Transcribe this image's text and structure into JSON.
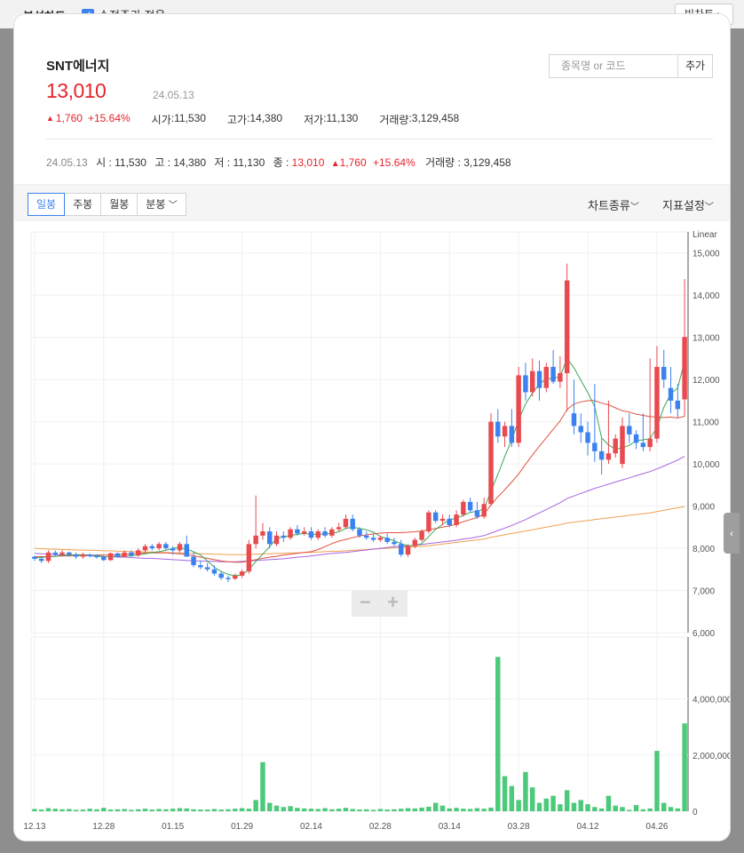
{
  "header": {
    "title": "분석차트",
    "adjusted_label": "수정주가 적용",
    "big_chart_label": "빅차트"
  },
  "stock": {
    "name": "SNT에너지",
    "price": "13,010",
    "date": "24.05.13",
    "change": "1,760",
    "change_pct": "+15.64%",
    "open_label": "시가",
    "open": "11,530",
    "high_label": "고가",
    "high": "14,380",
    "low_label": "저가",
    "low": "11,130",
    "volume_label": "거래량",
    "volume": "3,129,458"
  },
  "search": {
    "placeholder": "종목명 or 코드",
    "add_label": "추가"
  },
  "detail": {
    "date": "24.05.13",
    "o_label": "시",
    "o": "11,530",
    "h_label": "고",
    "h": "14,380",
    "l_label": "저",
    "l": "11,130",
    "c_label": "종",
    "c": "13,010",
    "change": "1,760",
    "pct": "+15.64%",
    "v_label": "거래량",
    "v": "3,129,458"
  },
  "toolbar": {
    "tabs": [
      "일봉",
      "주봉",
      "월봉",
      "분봉"
    ],
    "active_tab": "일봉",
    "chart_type_label": "차트종류",
    "indicator_label": "지표설정"
  },
  "zoom": {
    "minus": "−",
    "plus": "+"
  },
  "colors": {
    "up": "#e84a4f",
    "down": "#3b82f0",
    "volume": "#4cc97a",
    "ma5": "#3aa757",
    "ma20": "#e0533f",
    "ma60": "#a766e0",
    "ma120": "#f0a050"
  },
  "chart_data": {
    "type": "candlestick",
    "scale_label": "Linear",
    "price_ylim": [
      6000,
      15500
    ],
    "price_ticks": [
      "15,000",
      "14,000",
      "13,000",
      "12,000",
      "11,000",
      "10,000",
      "9,000",
      "8,000",
      "7,000",
      "6,000"
    ],
    "volume_ylim": [
      0,
      5700000
    ],
    "volume_ticks": [
      "4,000,000",
      "2,000,000",
      "0"
    ],
    "x_labels": [
      "12.13",
      "12.28",
      "01.15",
      "01.29",
      "02.14",
      "02.28",
      "03.14",
      "03.28",
      "04.12",
      "04.26"
    ],
    "x_label_index": [
      0,
      10,
      20,
      30,
      40,
      50,
      60,
      70,
      80,
      90
    ],
    "ohlc": [
      [
        7800,
        7820,
        7700,
        7750
      ],
      [
        7750,
        7800,
        7650,
        7700
      ],
      [
        7700,
        7950,
        7650,
        7900
      ],
      [
        7900,
        7950,
        7800,
        7850
      ],
      [
        7850,
        7950,
        7800,
        7900
      ],
      [
        7900,
        7920,
        7800,
        7850
      ],
      [
        7850,
        7900,
        7750,
        7800
      ],
      [
        7800,
        7900,
        7750,
        7850
      ],
      [
        7850,
        7880,
        7780,
        7820
      ],
      [
        7820,
        7860,
        7760,
        7800
      ],
      [
        7800,
        7850,
        7700,
        7720
      ],
      [
        7720,
        7900,
        7700,
        7880
      ],
      [
        7880,
        7900,
        7780,
        7800
      ],
      [
        7800,
        7950,
        7780,
        7900
      ],
      [
        7900,
        7950,
        7800,
        7830
      ],
      [
        7830,
        8000,
        7800,
        7950
      ],
      [
        7950,
        8100,
        7900,
        8050
      ],
      [
        8050,
        8100,
        7950,
        8000
      ],
      [
        8000,
        8150,
        7950,
        8100
      ],
      [
        8100,
        8150,
        7950,
        8000
      ],
      [
        8000,
        8050,
        7850,
        7950
      ],
      [
        7950,
        8150,
        7900,
        8100
      ],
      [
        8100,
        8300,
        7900,
        7800
      ],
      [
        7800,
        7900,
        7550,
        7600
      ],
      [
        7600,
        7700,
        7500,
        7550
      ],
      [
        7550,
        7650,
        7450,
        7500
      ],
      [
        7500,
        7600,
        7350,
        7400
      ],
      [
        7400,
        7450,
        7250,
        7300
      ],
      [
        7300,
        7350,
        7200,
        7280
      ],
      [
        7280,
        7400,
        7250,
        7350
      ],
      [
        7350,
        7500,
        7300,
        7450
      ],
      [
        7450,
        8200,
        7400,
        8100
      ],
      [
        8100,
        9250,
        8000,
        8300
      ],
      [
        8300,
        8600,
        8200,
        8400
      ],
      [
        8400,
        8500,
        8000,
        8100
      ],
      [
        8100,
        8400,
        8050,
        8300
      ],
      [
        8300,
        8400,
        8150,
        8250
      ],
      [
        8250,
        8500,
        8200,
        8450
      ],
      [
        8450,
        8550,
        8300,
        8350
      ],
      [
        8350,
        8500,
        8300,
        8400
      ],
      [
        8400,
        8500,
        8200,
        8250
      ],
      [
        8250,
        8450,
        8200,
        8400
      ],
      [
        8400,
        8500,
        8250,
        8300
      ],
      [
        8300,
        8500,
        8250,
        8450
      ],
      [
        8450,
        8600,
        8400,
        8500
      ],
      [
        8500,
        8800,
        8450,
        8700
      ],
      [
        8700,
        8800,
        8400,
        8450
      ],
      [
        8450,
        8500,
        8250,
        8300
      ],
      [
        8300,
        8400,
        8200,
        8250
      ],
      [
        8250,
        8350,
        8150,
        8200
      ],
      [
        8200,
        8300,
        8150,
        8250
      ],
      [
        8250,
        8350,
        8100,
        8150
      ],
      [
        8150,
        8250,
        8050,
        8100
      ],
      [
        8100,
        8200,
        7800,
        7850
      ],
      [
        7850,
        8100,
        7800,
        8050
      ],
      [
        8050,
        8250,
        8000,
        8200
      ],
      [
        8200,
        8450,
        8150,
        8400
      ],
      [
        8400,
        8900,
        8350,
        8850
      ],
      [
        8850,
        8900,
        8600,
        8650
      ],
      [
        8650,
        8800,
        8550,
        8700
      ],
      [
        8700,
        8800,
        8500,
        8550
      ],
      [
        8550,
        8900,
        8500,
        8800
      ],
      [
        8800,
        9150,
        8750,
        9100
      ],
      [
        9100,
        9200,
        8850,
        8900
      ],
      [
        8900,
        9100,
        8700,
        8750
      ],
      [
        8750,
        9200,
        8700,
        9050
      ],
      [
        9050,
        11200,
        9000,
        11000
      ],
      [
        11000,
        11300,
        10500,
        10650
      ],
      [
        10650,
        11000,
        10400,
        10900
      ],
      [
        10900,
        11300,
        10400,
        10500
      ],
      [
        10500,
        12300,
        10400,
        12100
      ],
      [
        12100,
        12400,
        11500,
        11700
      ],
      [
        11700,
        12500,
        11600,
        12200
      ],
      [
        12200,
        12450,
        11500,
        11800
      ],
      [
        11800,
        12400,
        11700,
        12300
      ],
      [
        12300,
        12700,
        11900,
        11950
      ],
      [
        11950,
        12550,
        11800,
        12150
      ],
      [
        12150,
        14750,
        11250,
        14350
      ],
      [
        11200,
        12000,
        10700,
        10900
      ],
      [
        10900,
        11200,
        10500,
        10750
      ],
      [
        10750,
        11000,
        10200,
        10500
      ],
      [
        10500,
        11900,
        10050,
        10300
      ],
      [
        10300,
        10600,
        9750,
        10100
      ],
      [
        10100,
        11500,
        10000,
        10250
      ],
      [
        10250,
        10700,
        10150,
        10600
      ],
      [
        10000,
        11100,
        9900,
        10900
      ],
      [
        10900,
        11200,
        10500,
        10700
      ],
      [
        10700,
        10800,
        10350,
        10500
      ],
      [
        10500,
        11200,
        10300,
        10400
      ],
      [
        10400,
        12500,
        10300,
        10600
      ],
      [
        10600,
        12800,
        10500,
        12300
      ],
      [
        12300,
        12700,
        11800,
        12000
      ],
      [
        11800,
        12300,
        11200,
        11500
      ],
      [
        11500,
        11900,
        11100,
        11300
      ],
      [
        11530,
        14380,
        11130,
        13010
      ]
    ],
    "volume": [
      80000,
      60000,
      110000,
      90000,
      70000,
      80000,
      50000,
      60000,
      90000,
      70000,
      120000,
      60000,
      70000,
      80000,
      50000,
      70000,
      90000,
      60000,
      80000,
      70000,
      90000,
      110000,
      100000,
      70000,
      60000,
      60000,
      80000,
      60000,
      70000,
      90000,
      110000,
      90000,
      400000,
      1750000,
      300000,
      200000,
      150000,
      180000,
      120000,
      100000,
      90000,
      80000,
      110000,
      70000,
      90000,
      120000,
      80000,
      60000,
      70000,
      50000,
      80000,
      60000,
      70000,
      90000,
      110000,
      100000,
      130000,
      160000,
      300000,
      200000,
      100000,
      120000,
      90000,
      80000,
      110000,
      90000,
      130000,
      5500000,
      1250000,
      900000,
      400000,
      1400000,
      850000,
      300000,
      450000,
      550000,
      250000,
      750000,
      300000,
      400000,
      250000,
      150000,
      100000,
      550000,
      200000,
      150000,
      50000,
      220000,
      70000,
      100000,
      2150000,
      300000,
      150000,
      100000,
      3130000
    ],
    "ma5": [
      7770,
      7780,
      7800,
      7810,
      7830,
      7840,
      7850,
      7850,
      7840,
      7830,
      7800,
      7800,
      7810,
      7820,
      7820,
      7840,
      7870,
      7900,
      7920,
      7950,
      8000,
      8020,
      7980,
      7920,
      7840,
      7700,
      7550,
      7450,
      7380,
      7350,
      7370,
      7500,
      7690,
      7860,
      8040,
      8230,
      8270,
      8300,
      8330,
      8350,
      8330,
      8330,
      8340,
      8350,
      8390,
      8470,
      8500,
      8470,
      8440,
      8380,
      8280,
      8230,
      8180,
      8110,
      8060,
      8070,
      8110,
      8280,
      8450,
      8570,
      8680,
      8710,
      8780,
      8850,
      8880,
      8930,
      9360,
      9750,
      10180,
      10570,
      11040,
      11420,
      11680,
      11890,
      12020,
      12030,
      12070,
      12500,
      12280,
      11980,
      11690,
      11360,
      10620,
      10450,
      10350,
      10380,
      10440,
      10550,
      10570,
      10600,
      10860,
      11340,
      11660,
      11800,
      12440
    ],
    "ma20": [
      7800,
      7800,
      7800,
      7810,
      7820,
      7820,
      7830,
      7830,
      7830,
      7840,
      7840,
      7840,
      7850,
      7860,
      7870,
      7880,
      7890,
      7890,
      7890,
      7890,
      7880,
      7870,
      7850,
      7820,
      7790,
      7760,
      7730,
      7700,
      7680,
      7670,
      7670,
      7700,
      7730,
      7760,
      7790,
      7810,
      7840,
      7860,
      7880,
      7900,
      7920,
      7970,
      8040,
      8110,
      8170,
      8210,
      8250,
      8290,
      8320,
      8340,
      8360,
      8370,
      8370,
      8370,
      8380,
      8390,
      8410,
      8440,
      8470,
      8500,
      8530,
      8570,
      8630,
      8680,
      8730,
      8810,
      9030,
      9220,
      9390,
      9570,
      9760,
      9990,
      10210,
      10420,
      10620,
      10820,
      11020,
      11290,
      11420,
      11470,
      11500,
      11500,
      11440,
      11400,
      11330,
      11260,
      11230,
      11180,
      11150,
      11120,
      11110,
      11100,
      11110,
      11090,
      11130
    ],
    "ma60": [
      7880,
      7870,
      7860,
      7850,
      7840,
      7840,
      7830,
      7830,
      7820,
      7810,
      7800,
      7800,
      7790,
      7790,
      7780,
      7770,
      7760,
      7760,
      7750,
      7740,
      7730,
      7720,
      7710,
      7700,
      7700,
      7690,
      7690,
      7680,
      7680,
      7680,
      7690,
      7700,
      7710,
      7720,
      7730,
      7740,
      7750,
      7770,
      7790,
      7800,
      7820,
      7840,
      7860,
      7880,
      7890,
      7900,
      7920,
      7940,
      7960,
      7980,
      8000,
      8020,
      8040,
      8050,
      8060,
      8070,
      8090,
      8110,
      8130,
      8150,
      8170,
      8190,
      8220,
      8240,
      8270,
      8300,
      8360,
      8420,
      8480,
      8540,
      8610,
      8680,
      8760,
      8840,
      8920,
      9000,
      9080,
      9180,
      9240,
      9300,
      9360,
      9420,
      9470,
      9520,
      9570,
      9620,
      9670,
      9720,
      9770,
      9820,
      9880,
      9950,
      10020,
      10090,
      10180
    ],
    "ma120": [
      8000,
      7990,
      7980,
      7980,
      7970,
      7970,
      7960,
      7960,
      7950,
      7950,
      7940,
      7940,
      7930,
      7930,
      7920,
      7920,
      7910,
      7910,
      7900,
      7900,
      7890,
      7890,
      7880,
      7880,
      7870,
      7870,
      7860,
      7860,
      7850,
      7850,
      7850,
      7860,
      7860,
      7870,
      7870,
      7880,
      7880,
      7890,
      7890,
      7900,
      7900,
      7910,
      7920,
      7930,
      7930,
      7940,
      7950,
      7960,
      7970,
      7980,
      7990,
      8000,
      8010,
      8020,
      8030,
      8040,
      8050,
      8060,
      8080,
      8100,
      8120,
      8140,
      8160,
      8180,
      8200,
      8220,
      8260,
      8290,
      8320,
      8350,
      8380,
      8410,
      8440,
      8470,
      8500,
      8530,
      8560,
      8600,
      8620,
      8640,
      8660,
      8680,
      8700,
      8720,
      8740,
      8760,
      8780,
      8800,
      8820,
      8840,
      8870,
      8900,
      8930,
      8960,
      8990
    ]
  }
}
